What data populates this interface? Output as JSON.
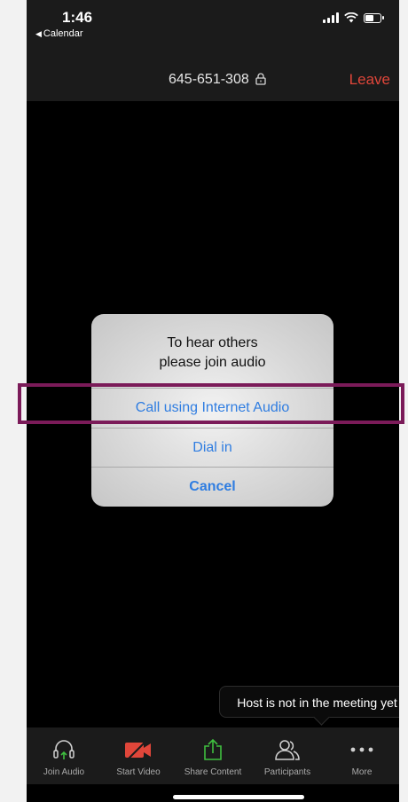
{
  "status_bar": {
    "time": "1:46",
    "back_label": "Calendar"
  },
  "header": {
    "meeting_id": "645-651-308",
    "leave_label": "Leave"
  },
  "dialog": {
    "title_line1": "To hear others",
    "title_line2": "please join audio",
    "actions": [
      {
        "label": "Call using Internet Audio"
      },
      {
        "label": "Dial in"
      },
      {
        "label": "Cancel"
      }
    ]
  },
  "tooltip": {
    "text": "Host is not in the meeting yet"
  },
  "toolbar": {
    "items": [
      {
        "label": "Join Audio",
        "icon": "headphones-icon"
      },
      {
        "label": "Start Video",
        "icon": "video-off-icon"
      },
      {
        "label": "Share Content",
        "icon": "share-icon"
      },
      {
        "label": "Participants",
        "icon": "participants-icon"
      },
      {
        "label": "More",
        "icon": "more-icon"
      }
    ]
  },
  "colors": {
    "accent": "#2f7de1",
    "leave": "#e0463a",
    "highlight": "#7b1b59",
    "share": "#3fbf3f",
    "video_off": "#e0463a"
  }
}
